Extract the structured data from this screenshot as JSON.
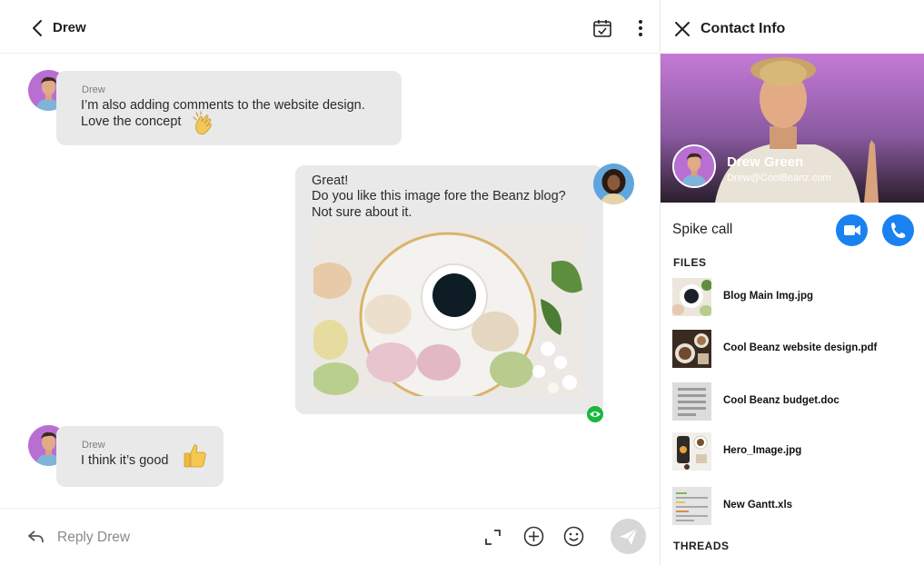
{
  "chat": {
    "header_title": "Drew",
    "messages": [
      {
        "sender": "Drew",
        "lines": [
          "I’m also adding comments to the website design.",
          "Love the concept"
        ],
        "emoji": "clapping-hands"
      },
      {
        "sender": "",
        "lines": [
          "Great!",
          "Do you like this image fore the Beanz blog?",
          "Not sure about it."
        ],
        "attachment": "macarons-coffee-image"
      },
      {
        "sender": "Drew",
        "lines": [
          "I think it’s good"
        ],
        "emoji": "thumbs-up"
      }
    ],
    "composer": {
      "placeholder": "Reply Drew"
    }
  },
  "contact": {
    "panel_title": "Contact Info",
    "name": "Drew Green",
    "email": "Drew@CoolBeanz.com",
    "spike_call_label": "Spike call",
    "files_title": "FILES",
    "files": [
      {
        "name": "Blog Main Img.jpg",
        "thumb": "coffee-photo"
      },
      {
        "name": "Cool Beanz website design.pdf",
        "thumb": "coffee-flatlay-photo"
      },
      {
        "name": "Cool Beanz budget.doc",
        "thumb": "document-thumb"
      },
      {
        "name": "Hero_Image.jpg",
        "thumb": "coffee-cup-photo"
      },
      {
        "name": "New Gantt.xls",
        "thumb": "spreadsheet-thumb"
      }
    ],
    "threads_title": "THREADS"
  },
  "colors": {
    "accent": "#1a82f0",
    "seen": "#19b83a",
    "bubble": "#e9e9e9",
    "hero_top": "#c47ad6"
  }
}
